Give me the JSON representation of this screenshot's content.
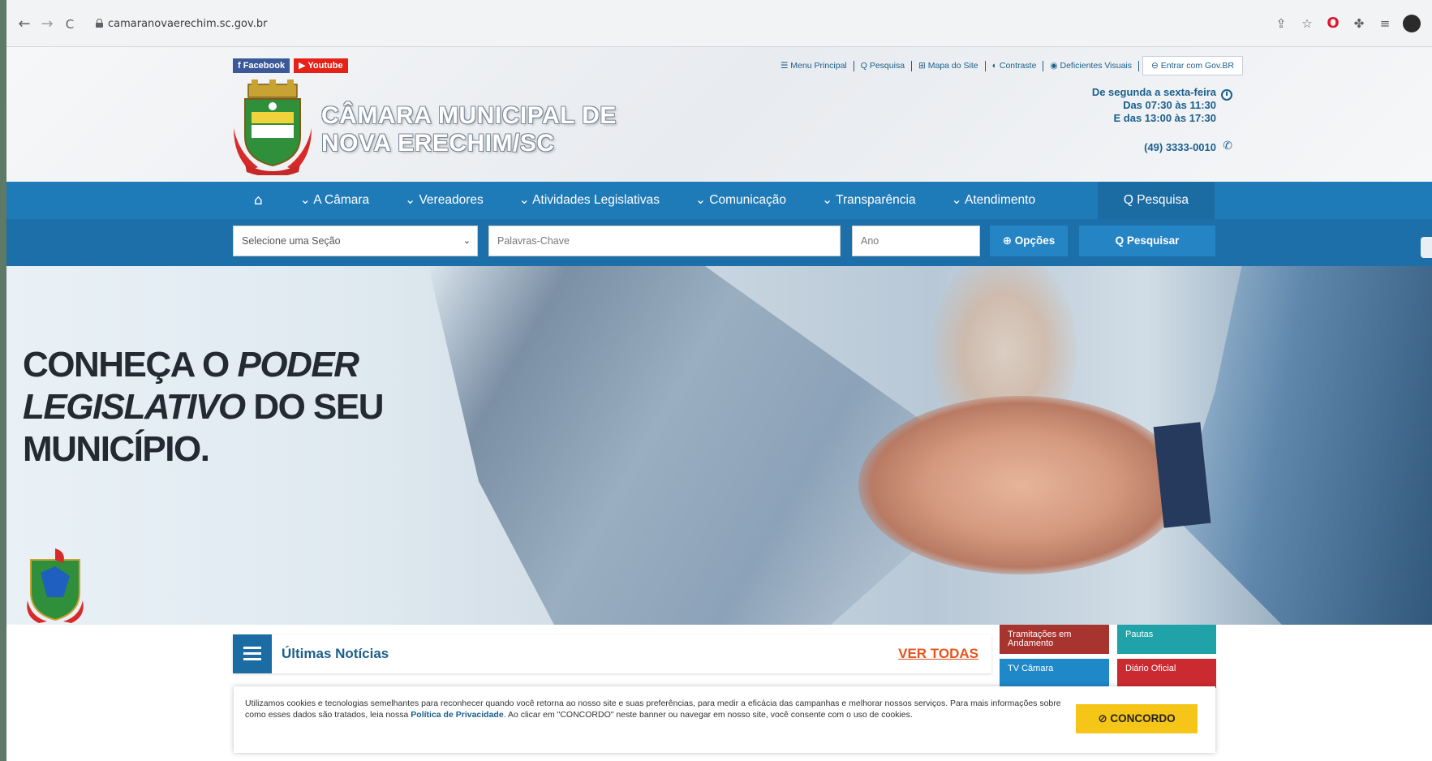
{
  "browser": {
    "url": "camaranovaerechim.sc.gov.br",
    "back_glyph": "←",
    "forward_glyph": "→",
    "reload_glyph": "C"
  },
  "top_bar": {
    "social": [
      {
        "label": "f Facebook",
        "icon": "facebook-icon",
        "color": "#3b5998"
      },
      {
        "label": "▶ Youtube",
        "icon": "youtube-icon",
        "color": "#e62117"
      }
    ],
    "links": [
      {
        "label": "☰ Menu Principal"
      },
      {
        "label": "Q Pesquisa"
      },
      {
        "label": "⊞ Mapa do Site"
      },
      {
        "label": "◐ Contraste"
      },
      {
        "label": "◉ Deficientes Visuais"
      }
    ],
    "gov_login": "⊖ Entrar com Gov.BR"
  },
  "header": {
    "title_line1": "CÂMARA MUNICIPAL DE",
    "title_line2": "NOVA ERECHIM/SC",
    "hours": [
      "De segunda a sexta-feira",
      "Das 07:30 às 11:30",
      "E das 13:00 às 17:30"
    ],
    "phone": "(49) 3333-0010"
  },
  "nav": {
    "home_glyph": "⌂",
    "items": [
      {
        "label": "⌄ A Câmara"
      },
      {
        "label": "⌄ Vereadores"
      },
      {
        "label": "⌄ Atividades Legislativas"
      },
      {
        "label": "⌄ Comunicação"
      },
      {
        "label": "⌄ Transparência"
      },
      {
        "label": "⌄ Atendimento"
      }
    ],
    "search_label": "Q Pesquisa"
  },
  "search": {
    "section_placeholder": "Selecione uma Seção",
    "keywords_placeholder": "Palavras-Chave",
    "year_placeholder": "Ano",
    "options_label": "⊕ Opções",
    "search_button": "Q Pesquisar"
  },
  "hero": {
    "line1_normal": "CONHEÇA O ",
    "line1_em": "PODER",
    "line2_em": "LEGISLATIVO",
    "line2_normal": " DO SEU",
    "line3": "MUNICÍPIO."
  },
  "news": {
    "title": "Últimas Notícias",
    "see_all": "VER TODAS"
  },
  "tiles": [
    {
      "label": "Tramitações em Andamento",
      "color": "#a8342f"
    },
    {
      "label": "Pautas",
      "color": "#1fa3a8"
    },
    {
      "label": "TV Câmara",
      "color": "#1e88c9"
    },
    {
      "label": "Diário Oficial",
      "color": "#cc2a31"
    }
  ],
  "cookie": {
    "text_before": "Utilizamos cookies e tecnologias semelhantes para reconhecer quando você retorna ao nosso site e suas preferências, para medir a eficácia das campanhas e melhorar nossos serviços. Para mais informações sobre como esses dados são tratados, leia nossa ",
    "link": "Política de Privacidade",
    "text_after": ". Ao clicar em \"CONCORDO\" neste banner ou navegar em nosso site, você consente com o uso de cookies.",
    "accept": "⊘ CONCORDO"
  }
}
